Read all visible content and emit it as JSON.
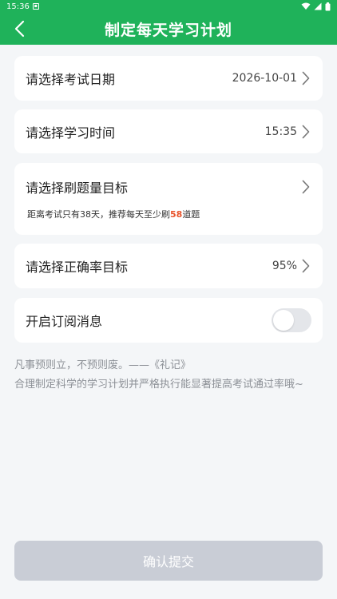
{
  "status_bar": {
    "time": "15:36"
  },
  "header": {
    "title": "制定每天学习计划"
  },
  "exam_date": {
    "label": "请选择考试日期",
    "value": "2026-10-01"
  },
  "study_time": {
    "label": "请选择学习时间",
    "value": "15:35"
  },
  "question_goal": {
    "label": "请选择刷题量目标",
    "hint_prefix": "距离考试只有38天，推荐每天至少刷",
    "hint_number": "58",
    "hint_suffix": "道题"
  },
  "accuracy_goal": {
    "label": "请选择正确率目标",
    "value": "95%"
  },
  "subscribe": {
    "label": "开启订阅消息",
    "enabled": false
  },
  "quote": {
    "line1": "凡事预则立，不预则废。——《礼记》",
    "line2": "合理制定科学的学习计划并严格执行能显著提高考试通过率哦~"
  },
  "submit": {
    "label": "确认提交"
  },
  "colors": {
    "brand": "#1fb25a",
    "highlight": "#e8532b",
    "disabled_button": "#c9cdd6",
    "background": "#f4f6f8"
  }
}
